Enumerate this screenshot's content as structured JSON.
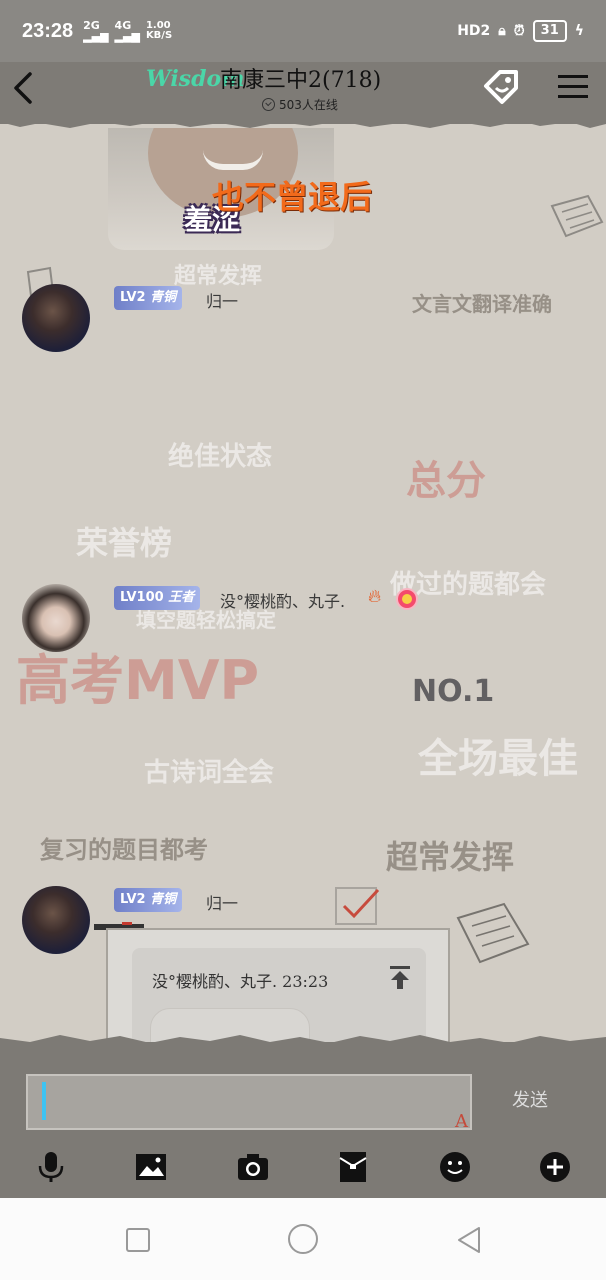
{
  "status_bar": {
    "time": "23:28",
    "signal_2g": "2G",
    "signal_4g": "4G",
    "speed_value": "1.00",
    "speed_unit": "KB/S",
    "hd_label": "HD2",
    "battery": "31"
  },
  "header": {
    "logo": "Wisdom",
    "title": "南康三中2(718)",
    "online": "503人在线"
  },
  "background_decor": {
    "t1": "超常发挥",
    "t2": "文言文翻译准确",
    "t3": "绝佳状态",
    "t4": "总分",
    "t5": "荣誉榜",
    "t6": "做过的题都会",
    "t7": "填空题轻松搞定",
    "t8": "高考MVP",
    "t9": "NO.1",
    "t10": "全场最佳",
    "t11": "古诗词全会",
    "t12": "复习的题目都考",
    "t13": "超常发挥"
  },
  "image_message": {
    "caption": "羞涩",
    "overlay": "也不曾退后"
  },
  "messages": [
    {
      "level_prefix": "LV2",
      "level_title": "青铜",
      "sender": "归一"
    },
    {
      "level_prefix": "LV100",
      "level_title": "王者",
      "sender": "没°樱桃酌、丸子."
    },
    {
      "level_prefix": "LV2",
      "level_title": "青铜",
      "sender": "归一"
    }
  ],
  "quote": {
    "text": "没°樱桃酌、丸子. 23:23"
  },
  "input": {
    "value": "",
    "send_label": "发送"
  },
  "toolbar_icons": [
    "microphone-icon",
    "image-icon",
    "camera-icon",
    "red-packet-icon",
    "emoji-icon",
    "plus-icon"
  ],
  "colors": {
    "level_badge": "#8a98d8",
    "cursor": "#3ec3f2",
    "logo": "#4bd6a8",
    "overlay_text": "#f26a1b"
  }
}
